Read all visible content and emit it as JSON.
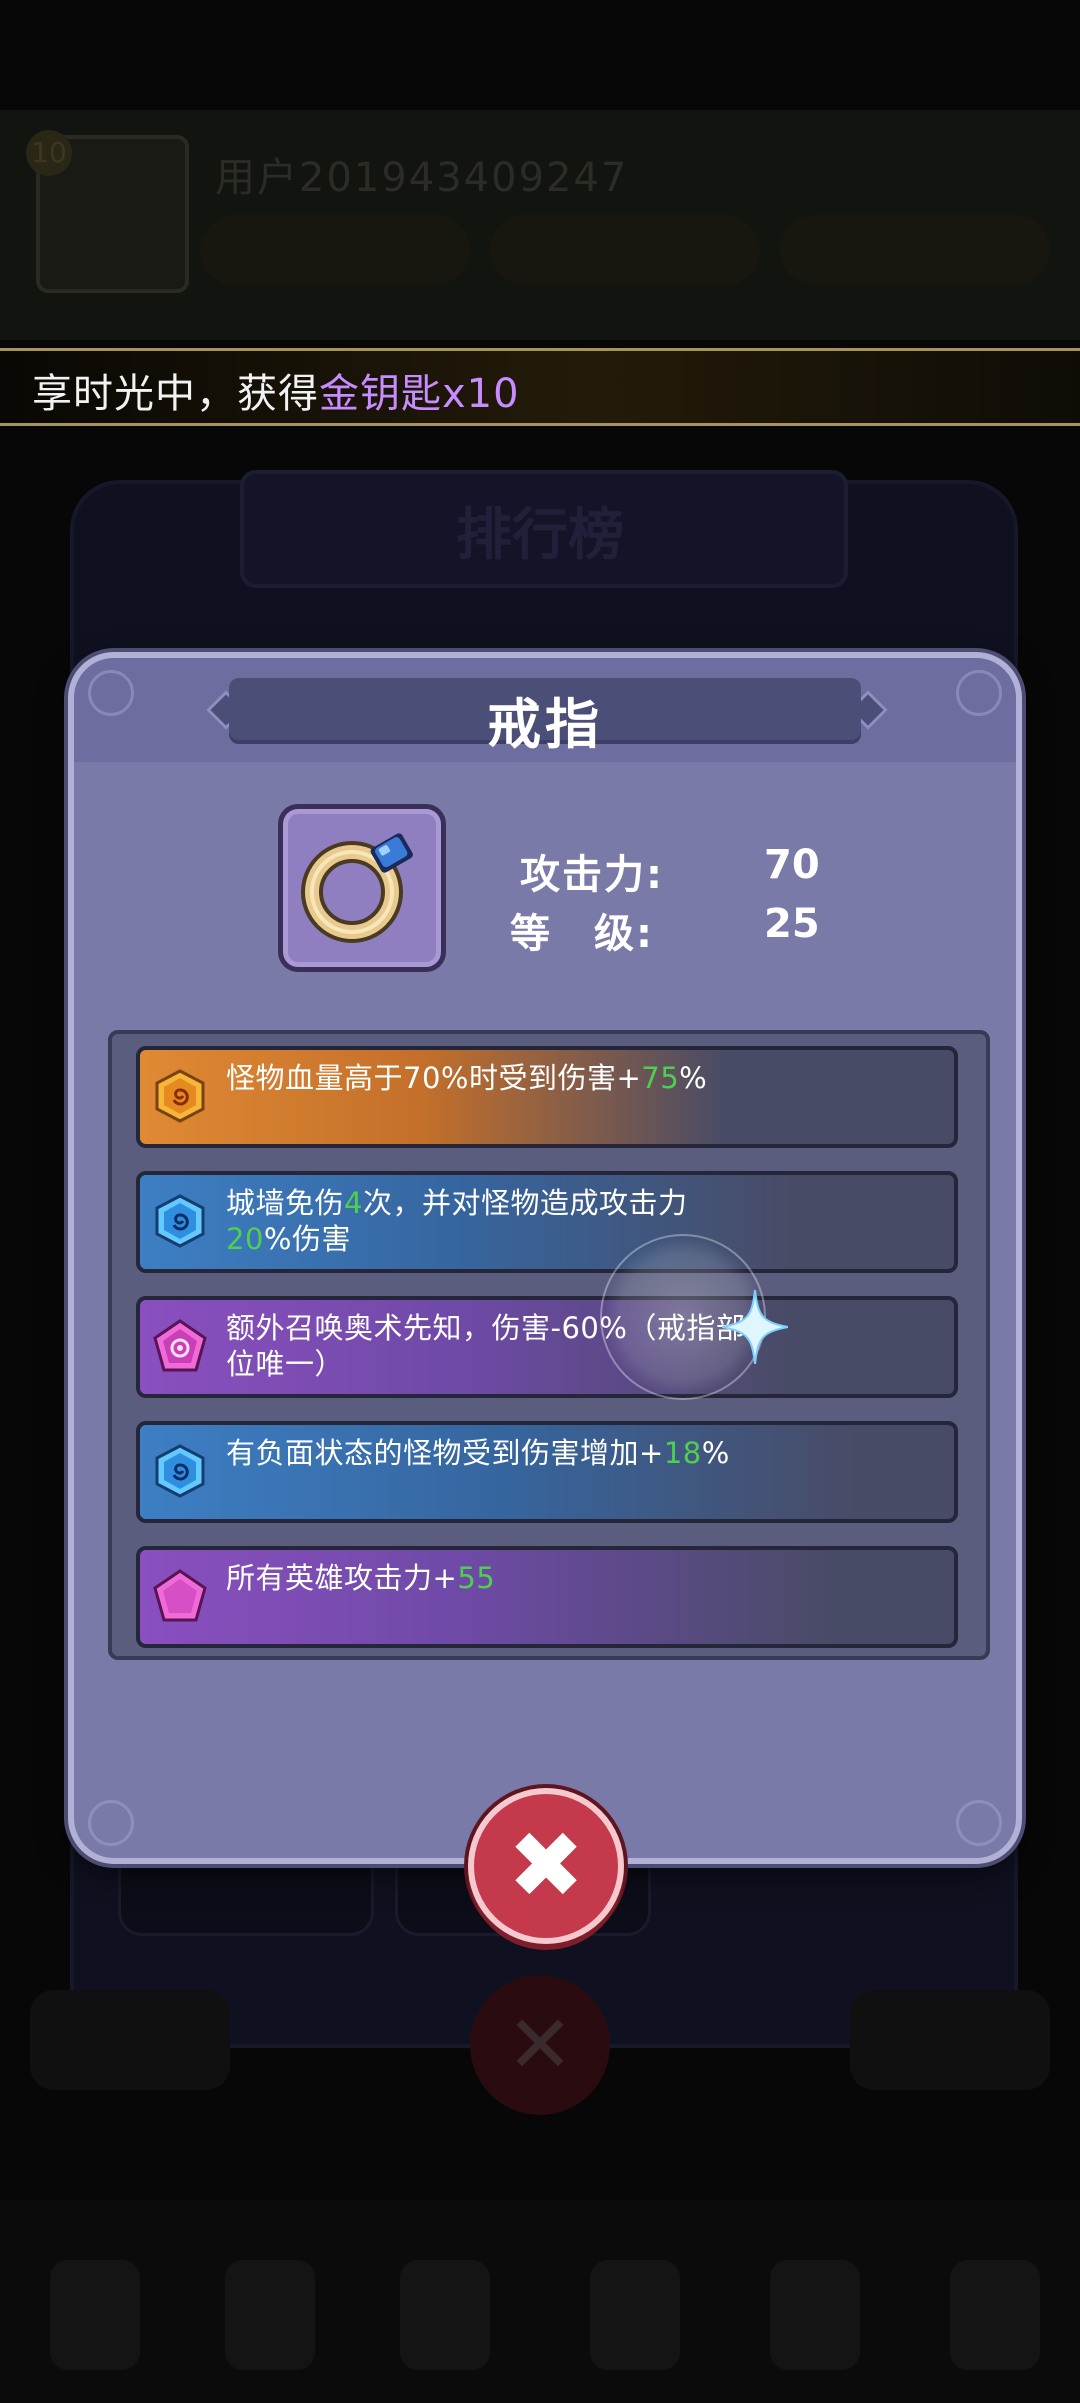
{
  "background": {
    "player_name": "用户201943409247",
    "title": "排行榜"
  },
  "banner": {
    "prefix": "享时光中，获得",
    "highlight": "金钥匙x10"
  },
  "popup": {
    "title": "戒指",
    "item_icon": "ring-icon",
    "stats": [
      {
        "label": "攻击力:",
        "value": "70"
      },
      {
        "label": "等　级:",
        "value": "25"
      }
    ],
    "affixes": [
      {
        "gem": "orange-hexagon-gem-icon",
        "text": "怪物血量高于70%时受到伤害+",
        "value": "75",
        "suffix": "%",
        "tint": "#e08a34"
      },
      {
        "gem": "blue-hexagon-gem-icon",
        "text": "城墙免伤",
        "value": "4",
        "suffix": "次，并对怪物造成攻击力",
        "value2": "20",
        "suffix2": "%伤害",
        "tint": "#3d7fc4"
      },
      {
        "gem": "purple-pentagon-gem-icon",
        "text": "额外召唤奥术先知，伤害-60%（戒指部位唯一）",
        "tint": "#8a4fc0"
      },
      {
        "gem": "blue-hexagon-gem-icon",
        "text": "有负面状态的怪物受到伤害增加+",
        "value": "18",
        "suffix": "%",
        "tint": "#3d7fc4"
      },
      {
        "gem": "purple-pentagon-gem-icon",
        "text": "所有英雄攻击力+",
        "value": "55",
        "suffix": "",
        "tint": "#8a4fc0"
      }
    ],
    "close_icon": "close-icon"
  },
  "colors": {
    "popup_bg": "#7a7aa8",
    "highlight_green": "#4fcf4f",
    "banner_highlight": "#c78cff",
    "close_red": "#c43a4c"
  }
}
